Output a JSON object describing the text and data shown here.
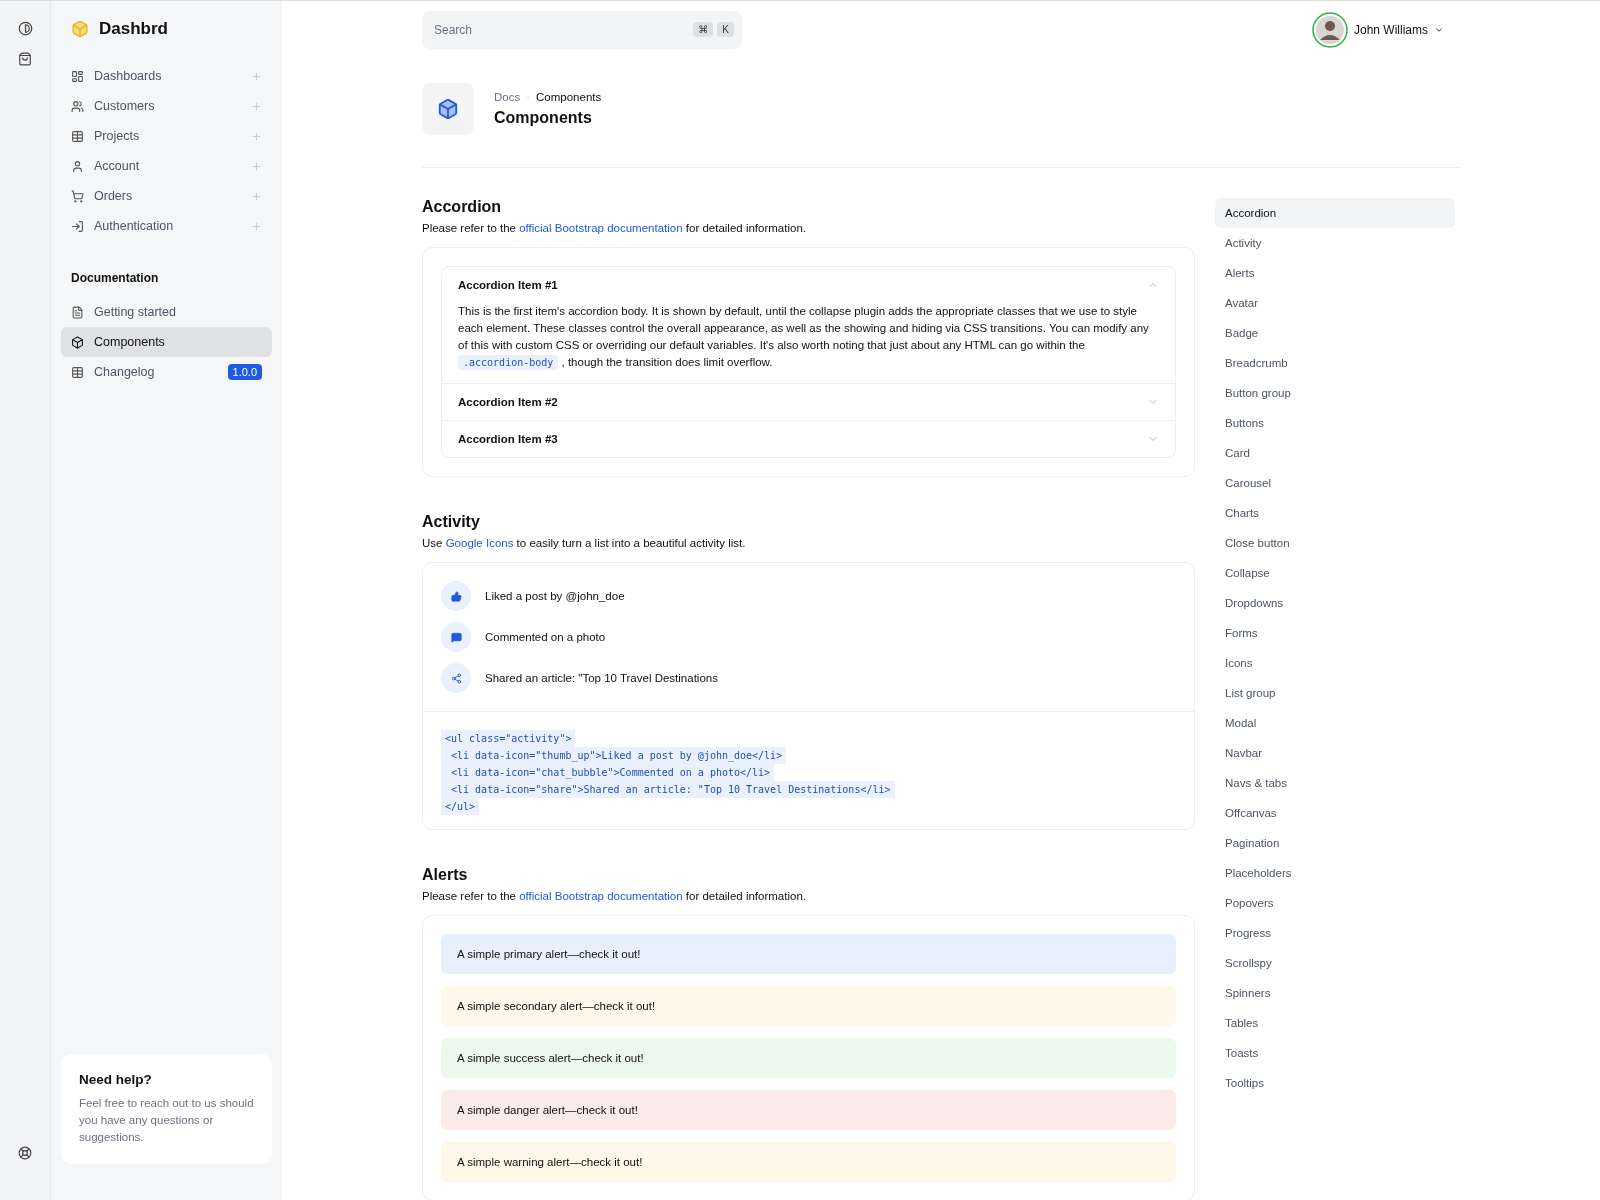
{
  "brand": {
    "name": "Dashbrd"
  },
  "nav": {
    "items": [
      {
        "label": "Dashboards"
      },
      {
        "label": "Customers"
      },
      {
        "label": "Projects"
      },
      {
        "label": "Account"
      },
      {
        "label": "Orders"
      },
      {
        "label": "Authentication"
      }
    ]
  },
  "docs": {
    "heading": "Documentation",
    "items": [
      {
        "label": "Getting started",
        "selected": false
      },
      {
        "label": "Components",
        "selected": true
      },
      {
        "label": "Changelog",
        "selected": false,
        "badge": "1.0.0"
      }
    ]
  },
  "help": {
    "title": "Need help?",
    "text": "Feel free to reach out to us should you have any questions or suggestions."
  },
  "search": {
    "placeholder": "Search",
    "keys": [
      "⌘",
      "K"
    ]
  },
  "user": {
    "name": "John Williams"
  },
  "page": {
    "breadcrumb": [
      "Docs",
      "Components"
    ],
    "breadcrumb_separator": "·",
    "title": "Components"
  },
  "accordion_section": {
    "title": "Accordion",
    "intro": [
      "Please refer to the ",
      "official Bootstrap documentation",
      " for detailed information."
    ],
    "items": [
      {
        "title": "Accordion Item #1",
        "expanded": true,
        "body": "This is the first item's accordion body. It is shown by default, until the collapse plugin adds the appropriate classes that we use to style each element. These classes control the overall appearance, as well as the showing and hiding via CSS transitions. You can modify any of this with custom CSS or overriding our default variables. It's also worth noting that just about any HTML can go within the ",
        "code": ".accordion-body",
        "after": ", though the transition does limit overflow."
      },
      {
        "title": "Accordion Item #2",
        "expanded": false
      },
      {
        "title": "Accordion Item #3",
        "expanded": false
      }
    ]
  },
  "activity_section": {
    "title": "Activity",
    "intro": [
      "Use ",
      "Google Icons",
      " to easily turn a list into a beautiful activity list."
    ],
    "items": [
      {
        "text": "Liked a post by @john_doe"
      },
      {
        "text": "Commented on a photo"
      },
      {
        "text": "Shared an article: \"Top 10 Travel Destinations"
      }
    ],
    "code": [
      "<ul class=\"activity\">",
      " <li data-icon=\"thumb_up\">Liked a post by @john_doe</li>",
      " <li data-icon=\"chat_bubble\">Commented on a photo</li>",
      " <li data-icon=\"share\">Shared an article: \"Top 10 Travel Destinations</li>",
      "</ul>"
    ]
  },
  "alerts_section": {
    "title": "Alerts",
    "intro": [
      "Please refer to the ",
      "official Bootstrap documentation",
      " for detailed information."
    ],
    "items": [
      {
        "kind": "primary",
        "text": "A simple primary alert—check it out!"
      },
      {
        "kind": "secondary",
        "text": "A simple secondary alert—check it out!"
      },
      {
        "kind": "success",
        "text": "A simple success alert—check it out!"
      },
      {
        "kind": "danger",
        "text": "A simple danger alert—check it out!"
      },
      {
        "kind": "warning",
        "text": "A simple warning alert—check it out!"
      }
    ]
  },
  "toc": {
    "items": [
      {
        "label": "Accordion",
        "selected": true
      },
      {
        "label": "Activity",
        "selected": false
      },
      {
        "label": "Alerts",
        "selected": false
      },
      {
        "label": "Avatar",
        "selected": false
      },
      {
        "label": "Badge",
        "selected": false
      },
      {
        "label": "Breadcrumb",
        "selected": false
      },
      {
        "label": "Button group",
        "selected": false
      },
      {
        "label": "Buttons",
        "selected": false
      },
      {
        "label": "Card",
        "selected": false
      },
      {
        "label": "Carousel",
        "selected": false
      },
      {
        "label": "Charts",
        "selected": false
      },
      {
        "label": "Close button",
        "selected": false
      },
      {
        "label": "Collapse",
        "selected": false
      },
      {
        "label": "Dropdowns",
        "selected": false
      },
      {
        "label": "Forms",
        "selected": false
      },
      {
        "label": "Icons",
        "selected": false
      },
      {
        "label": "List group",
        "selected": false
      },
      {
        "label": "Modal",
        "selected": false
      },
      {
        "label": "Navbar",
        "selected": false
      },
      {
        "label": "Navs & tabs",
        "selected": false
      },
      {
        "label": "Offcanvas",
        "selected": false
      },
      {
        "label": "Pagination",
        "selected": false
      },
      {
        "label": "Placeholders",
        "selected": false
      },
      {
        "label": "Popovers",
        "selected": false
      },
      {
        "label": "Progress",
        "selected": false
      },
      {
        "label": "Scrollspy",
        "selected": false
      },
      {
        "label": "Spinners",
        "selected": false
      },
      {
        "label": "Tables",
        "selected": false
      },
      {
        "label": "Toasts",
        "selected": false
      },
      {
        "label": "Tooltips",
        "selected": false
      }
    ]
  }
}
